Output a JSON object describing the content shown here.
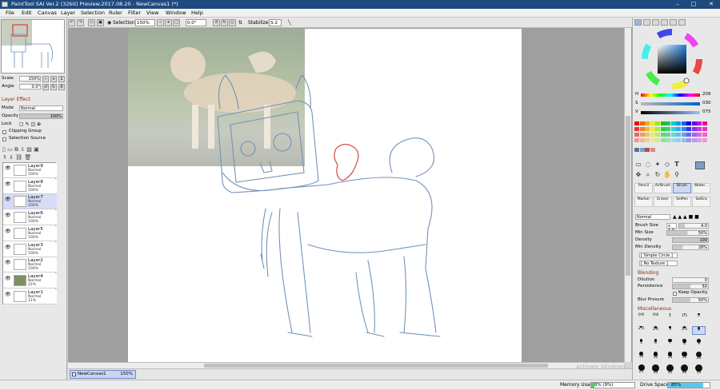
{
  "window": {
    "title": "PaintTool SAI Ver.2 (32bit) Preview.2017.08.20 - NewCanvas1 (*)",
    "controls": [
      "–",
      "□",
      "✕"
    ]
  },
  "menu": [
    "File",
    "Edit",
    "Canvas",
    "Layer",
    "Selection",
    "Ruler",
    "Filter",
    "View",
    "Window",
    "Help"
  ],
  "toolbar": {
    "selection_label": "Selection",
    "zoom": "150%",
    "angle": "0.0°",
    "stabilizer_label": "Stabilizer",
    "stabilizer_value": "S-2"
  },
  "navigator": {
    "scale_label": "Scale",
    "scale_value": "150%",
    "angle_label": "Angle",
    "angle_value": "0.0°"
  },
  "layer_effect": {
    "title": "Layer Effect",
    "mode_label": "Mode",
    "mode_value": "Normal",
    "opacity_label": "Opacity",
    "opacity_value": "100%",
    "lock_label": "Lock",
    "clipping_group": "Clipping Group",
    "selection_source": "Selection Source"
  },
  "layers": [
    {
      "name": "Layer9",
      "mode": "Normal",
      "opacity": "100%",
      "selected": false
    },
    {
      "name": "Layer8",
      "mode": "Normal",
      "opacity": "100%",
      "selected": false
    },
    {
      "name": "Layer7",
      "mode": "Normal",
      "opacity": "100%",
      "selected": true
    },
    {
      "name": "Layer6",
      "mode": "Normal",
      "opacity": "100%",
      "selected": false
    },
    {
      "name": "Layer5",
      "mode": "Normal",
      "opacity": "100%",
      "selected": false
    },
    {
      "name": "Layer3",
      "mode": "Normal",
      "opacity": "100%",
      "selected": false
    },
    {
      "name": "Layer2",
      "mode": "Normal",
      "opacity": "100%",
      "selected": false
    },
    {
      "name": "Layer4",
      "mode": "Normal",
      "opacity": "22%",
      "selected": false
    },
    {
      "name": "Layer1",
      "mode": "Normal",
      "opacity": "11%",
      "selected": false
    }
  ],
  "canvas_tab": {
    "name": "NewCanvas1",
    "zoom": "150%"
  },
  "status": {
    "memory_label": "Memory Usage",
    "memory_value": "8% (9%)",
    "memory_fraction": 0.08,
    "drive_label": "Drive Space",
    "drive_value": "85%",
    "drive_fraction": 0.85,
    "watermark": "Activate Windows"
  },
  "color": {
    "h_label": "H",
    "h_value": "209",
    "s_label": "S",
    "s_value": "030",
    "v_label": "V",
    "v_value": "075",
    "current": "#7a9fc6"
  },
  "brush_tools": [
    {
      "label": "Pencil",
      "selected": false
    },
    {
      "label": "AirBrush",
      "selected": false
    },
    {
      "label": "Brush",
      "selected": true
    },
    {
      "label": "Water...",
      "selected": false
    },
    {
      "label": "Marker",
      "selected": false
    },
    {
      "label": "Eraser",
      "selected": false
    },
    {
      "label": "SelPen",
      "selected": false
    },
    {
      "label": "SelEra",
      "selected": false
    }
  ],
  "brush": {
    "blend_mode": "Normal",
    "size_label": "Brush Size",
    "size_mult": "x 1.0",
    "size_value": "4.0",
    "min_size_label": "Min Size",
    "min_size_value": "50%",
    "density_label": "Density",
    "density_value": "100",
    "min_density_label": "Min Density",
    "min_density_value": "28%",
    "shape": "[ Simple Circle ]",
    "texture": "[ No Texture ]",
    "blending_title": "Blending",
    "dilution_label": "Dilution",
    "dilution_value": "0",
    "persistence_label": "Persistence",
    "persistence_value": "50",
    "keep_opacity": "Keep Opacity",
    "blur_label": "Blur Prssure",
    "blur_value": "50%",
    "misc_title": "Miscellaneous"
  },
  "brush_sizes": [
    "0.6",
    "0.8",
    "1",
    "1.5",
    "2",
    "2.3",
    "2.6",
    "3",
    "3.5",
    "4",
    "5",
    "6",
    "7",
    "8",
    "9",
    "10",
    "12",
    "14",
    "16",
    "20",
    "25",
    "30",
    "35",
    "40",
    "50"
  ]
}
